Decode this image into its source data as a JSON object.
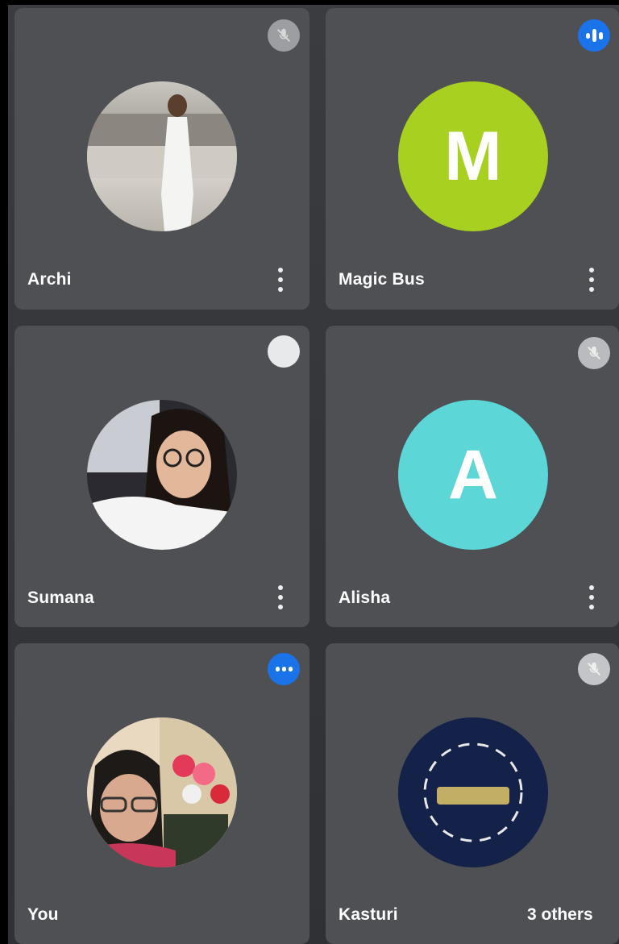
{
  "participants": [
    {
      "name": "Archi",
      "status": "muted",
      "avatar": "photo",
      "avatar_desc": "woman in white dress photo"
    },
    {
      "name": "Magic Bus",
      "status": "speaking",
      "avatar": "letter",
      "initial": "M",
      "avatar_color": "#a8d020"
    },
    {
      "name": "Sumana",
      "status": "idle",
      "avatar": "photo",
      "avatar_desc": "woman with glasses photo"
    },
    {
      "name": "Alisha",
      "status": "muted",
      "avatar": "letter",
      "initial": "A",
      "avatar_color": "#5cd6d6"
    },
    {
      "name": "You",
      "status": "speaking",
      "avatar": "photo",
      "avatar_desc": "woman with glasses and flowers photo"
    },
    {
      "name": "Kasturi",
      "status": "muted",
      "avatar": "photo",
      "avatar_desc": "success cycle poster"
    }
  ],
  "others_label": "3 others",
  "colors": {
    "tile": "#4e5054",
    "background": "#34363a",
    "accent_blue": "#1a73e8",
    "text": "#ffffff"
  },
  "icons": {
    "muted": "mic-off-icon",
    "speaking": "audio-wave-icon",
    "more": "more-vert-icon"
  }
}
